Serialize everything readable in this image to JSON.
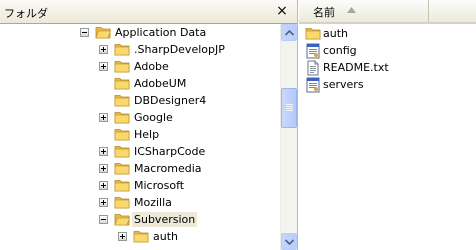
{
  "folder_pane": {
    "title": "フォルダ",
    "close_glyph": "×",
    "tree": [
      {
        "label": "Application Data",
        "toggle": "minus"
      },
      {
        "label": ".SharpDevelopJP",
        "toggle": "plus"
      },
      {
        "label": "Adobe",
        "toggle": "plus"
      },
      {
        "label": "AdobeUM",
        "toggle": "none"
      },
      {
        "label": "DBDesigner4",
        "toggle": "none"
      },
      {
        "label": "Google",
        "toggle": "plus"
      },
      {
        "label": "Help",
        "toggle": "none"
      },
      {
        "label": "ICSharpCode",
        "toggle": "plus"
      },
      {
        "label": "Macromedia",
        "toggle": "plus"
      },
      {
        "label": "Microsoft",
        "toggle": "plus"
      },
      {
        "label": "Mozilla",
        "toggle": "plus"
      },
      {
        "label": "Subversion",
        "toggle": "minus",
        "selected": true
      },
      {
        "label": "auth",
        "toggle": "plus"
      }
    ]
  },
  "file_pane": {
    "column_name": "名前",
    "files": [
      {
        "name": "auth",
        "icon": "folder-icon"
      },
      {
        "name": "config",
        "icon": "config-file-icon"
      },
      {
        "name": "README.txt",
        "icon": "text-file-icon"
      },
      {
        "name": "servers",
        "icon": "config-file-icon"
      }
    ]
  },
  "colors": {
    "folder_yellow": "#f5d35e",
    "selection_bg": "#ece9d8",
    "scrollbar_blue": "#c1d3fb"
  }
}
